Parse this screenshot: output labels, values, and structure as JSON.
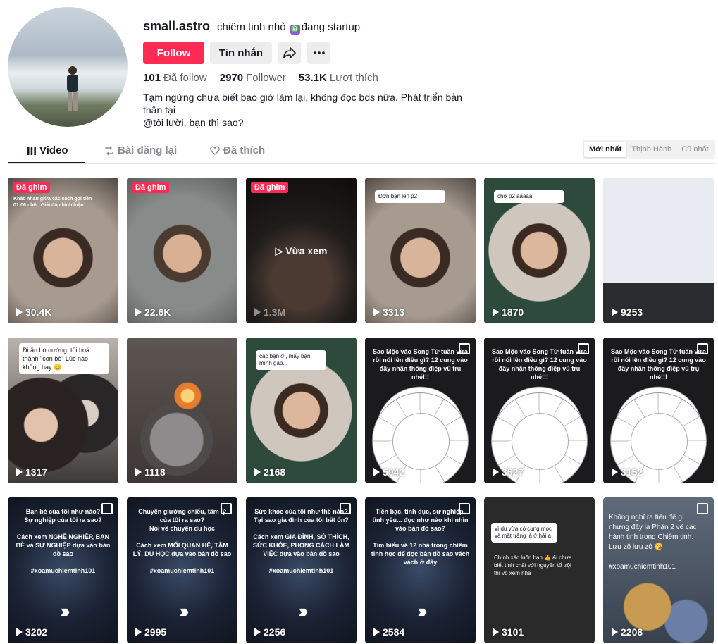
{
  "profile": {
    "username": "small.astro",
    "nickname_a": "chiêm tinh nhỏ",
    "nickname_icon": "♎",
    "nickname_b": "đang startup",
    "follow_label": "Follow",
    "message_label": "Tin nhắn",
    "stats": [
      {
        "value": "101",
        "label": "Đã follow"
      },
      {
        "value": "2970",
        "label": "Follower"
      },
      {
        "value": "53.1K",
        "label": "Lượt thích"
      }
    ],
    "bio_line1": "Tạm ngừng chưa biết bao giờ làm lại, không đọc bds nữa. Phát triển bản thân tại",
    "bio_line2": "@tôi lười, bạn thì sao?"
  },
  "tabs": [
    {
      "label": "Video",
      "icon": "grid-icon"
    },
    {
      "label": "Bài đăng lại",
      "icon": "repost-icon"
    },
    {
      "label": "Đã thích",
      "icon": "heart-icon"
    }
  ],
  "sort": [
    "Mới nhất",
    "Thịnh Hành",
    "Cũ nhất"
  ],
  "pinned_label": "Đã ghim",
  "watched_label": "Vừa xem",
  "videos": [
    {
      "views": "30.4K",
      "bg": "b-person",
      "pinned": true,
      "caption": "Khác nhau giữa các cách gọi tiền\n01:06 - hết: Giải đáp bình luận"
    },
    {
      "views": "22.6K",
      "bg": "b-person2",
      "pinned": true
    },
    {
      "views": "1.3M",
      "bg": "b-dark",
      "pinned": true,
      "watched": true
    },
    {
      "views": "3313",
      "bg": "b-person",
      "bubble": "Đơn bạn lên p2"
    },
    {
      "views": "1870",
      "bg": "b-green",
      "bubble": "chờ p2 aaaaa"
    },
    {
      "views": "9253",
      "bg": "b-chart"
    },
    {
      "views": "1317",
      "bg": "b-couple",
      "bubble": "Đi ăn bò nướng, tôi hoá thành \"con bò\" Lúc nào không hay 😊"
    },
    {
      "views": "1118",
      "bg": "b-fire"
    },
    {
      "views": "2168",
      "bg": "b-green",
      "bubble": "các bạn ơi, mấy bạn mình gặp..."
    },
    {
      "views": "5042",
      "bg": "b-zodiac",
      "gallery": true,
      "caption": "Sao Mộc vào Song Tử tuần vừa rồi nói lên điều gì? 12 cung vào đây nhận thông điệp vũ trụ nhé!!!",
      "wheel": true
    },
    {
      "views": "3527",
      "bg": "b-zodiac",
      "gallery": true,
      "caption": "Sao Mộc vào Song Tử tuần vừa rồi nói lên điều gì? 12 cung vào đây nhận thông điệp vũ trụ nhé!!!",
      "wheel": true
    },
    {
      "views": "3152",
      "bg": "b-zodiac",
      "gallery": true,
      "caption": "Sao Mộc vào Song Tử tuần vừa rồi nói lên điều gì? 12 cung vào đây nhận thông điệp vũ trụ nhé!!!",
      "wheel": true
    },
    {
      "views": "3202",
      "bg": "b-astro",
      "gallery": true,
      "caption": "Bạn bè của tôi như nào?\nSự nghiệp của tôi ra sao?\n\nCách xem NGHỀ NGHIỆP, BẠN BÈ và SỰ NGHIỆP dựa vào bản đồ sao\n\n#xoamuchiemtinh101",
      "arrows": true
    },
    {
      "views": "2995",
      "bg": "b-astro",
      "gallery": true,
      "caption": "Chuyện giường chiếu, tâm lý của tôi ra sao?\nNói về chuyện du học\n\nCách xem MỐI QUAN HỆ, TÂM LÝ, DU HỌC dựa vào bản đồ sao\n\n#xoamuchiemtinh101",
      "arrows": true
    },
    {
      "views": "2256",
      "bg": "b-astro",
      "gallery": true,
      "caption": "Sức khỏe của tôi như thế nào?\nTại sao gia đình của tôi bất ổn?\n\nCách xem GIA ĐÌNH, SỞ THÍCH, SỨC KHỎE, PHONG CÁCH LÀM VIỆC dựa vào bản đồ sao\n\n#xoamuchiemtinh101",
      "arrows": true
    },
    {
      "views": "2584",
      "bg": "b-astro",
      "gallery": true,
      "caption": "Tiền bạc, tình dục, sự nghiệp, tình yêu... đọc như nào khi nhìn vào bản đồ sao?\n\nTìm hiểu về 12 nhà trong chiêm tinh học để đọc bản đồ sao vách vách ở đây",
      "arrows": true
    },
    {
      "views": "3101",
      "bg": "b-black",
      "bubble": "vì dụ vừa có cung mọc và mặt trăng là ở hải a",
      "caption2": "Chính xác luôn bạn 👍 Ai chưa biết tính chất với nguyên tố trội thì vô xem nha"
    },
    {
      "views": "2208",
      "bg": "b-planets",
      "gallery": true,
      "caption": "Không nghĩ ra tiêu đề gì nhưng đây là Phần 2 về các hành tinh trong Chiêm tinh. Lưu zô lưu zô 😘\n\n#xoamuchiemtinh101"
    }
  ]
}
